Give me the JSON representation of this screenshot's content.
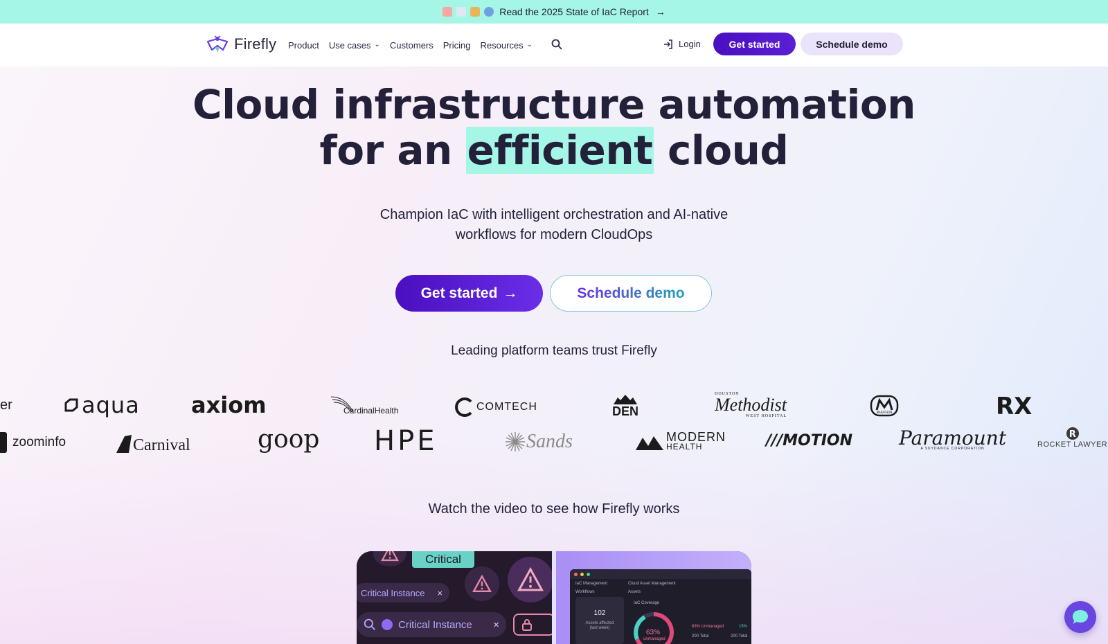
{
  "announcement": {
    "text": "Read the 2025 State of IaC Report",
    "arrow": "→"
  },
  "nav": {
    "brand": "Firefly",
    "links": [
      {
        "label": "Product",
        "has_dropdown": false
      },
      {
        "label": "Use cases",
        "has_dropdown": true
      },
      {
        "label": "Customers",
        "has_dropdown": false
      },
      {
        "label": "Pricing",
        "has_dropdown": false
      },
      {
        "label": "Resources",
        "has_dropdown": true
      }
    ],
    "login": "Login",
    "get_started": "Get started",
    "schedule_demo": "Schedule demo"
  },
  "hero": {
    "title_line1": "Cloud infrastructure automation",
    "title_line2_pre": "for an ",
    "title_highlight": "efficient",
    "title_line2_post": " cloud",
    "subtitle_line1": "Champion IaC with intelligent orchestration and AI-native",
    "subtitle_line2": "workflows for modern CloudOps",
    "cta_primary": "Get started",
    "cta_primary_arrow": "→",
    "cta_secondary": "Schedule demo"
  },
  "trust_heading": "Leading platform teams trust Firefly",
  "logos_row1": [
    "er",
    "aqua",
    "axiom",
    "CardinalHealth",
    "COMTECH",
    "DEN",
    "Methodist",
    "MARATHON",
    "RX"
  ],
  "logos_row2": [
    "zoominfo",
    "Carnival",
    "goop",
    "HPE",
    "Sands",
    "MODERN",
    "HEALTH",
    "MOTION",
    "Paramount",
    "ROCKET LAWYER"
  ],
  "logo_extras": {
    "houston": "HOUSTON",
    "west_hospital": "WEST HOSPITAL",
    "skydance": "A SKYDANCE CORPORATION"
  },
  "video": {
    "caption": "Watch the video to see how Firefly works",
    "critical_tag": "Critical",
    "pill1": "Critical Instance",
    "pill2": "Critical Instance",
    "dash_iac": "IaC Management",
    "dash_cloud": "Cloud Asset Management",
    "dash_workflows": "Workflows",
    "dash_assets": "Assets",
    "dash_coverage": "IaC Coverage",
    "card_value": "102",
    "card_label": "Assets affected",
    "card_sub": "(last week)",
    "gauge_value": "63%",
    "gauge_label": "unmanaged",
    "legend_unmanaged": "63% Unmanaged",
    "legend_other": "15%",
    "total_a": "200 Total",
    "total_b": "200 Total"
  },
  "colors": {
    "accent": "#4a0fbf",
    "mint": "#a5f6e6",
    "text": "#23213a"
  }
}
